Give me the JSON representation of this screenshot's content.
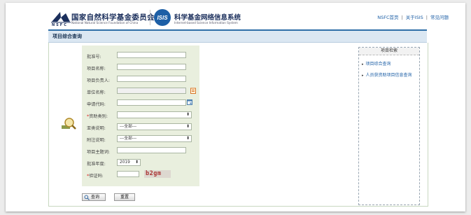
{
  "header": {
    "nsfc_cn": "国家自然科学基金委员会",
    "nsfc_en": "National Natural Science Foundation of China",
    "nsfc_abbr": "NSFC",
    "isis_abbr": "ISIS",
    "isis_cn": "科学基金网络信息系统",
    "isis_en": "Internet-based Science Information System",
    "links": [
      "NSFC首页",
      "关于ISIS",
      "常见问题"
    ],
    "link_separator": "|"
  },
  "page_title": "项目综合查询",
  "form": {
    "fields": [
      {
        "label": "批准号:",
        "type": "text",
        "value": "",
        "required": false
      },
      {
        "label": "项目名称:",
        "type": "text",
        "value": "",
        "required": false
      },
      {
        "label": "项目负责人:",
        "type": "text",
        "value": "",
        "required": false
      },
      {
        "label": "单位名称:",
        "type": "text",
        "value": "",
        "required": false
      },
      {
        "label": "申请代码:",
        "type": "text",
        "value": "",
        "required": false
      },
      {
        "label": "资助类别:",
        "type": "select",
        "value": "",
        "required": true
      },
      {
        "label": "亚类说明:",
        "type": "select",
        "value": "---全部---",
        "required": false
      },
      {
        "label": "附注说明:",
        "type": "select",
        "value": "---全部---",
        "required": false
      },
      {
        "label": "项目主题词:",
        "type": "text",
        "value": "",
        "required": false
      },
      {
        "label": "批准年度:",
        "type": "select",
        "value": "2019",
        "required": false
      },
      {
        "label": "验证码:",
        "type": "text",
        "value": "",
        "required": true
      }
    ],
    "captcha_text": "b2gm",
    "required_mark": "*",
    "search_button": "查询",
    "reset_button": "重置"
  },
  "sidebar": {
    "title": "项目检索",
    "links": [
      "项目综合查询",
      "人员获资助项目信息查询"
    ]
  },
  "colors": {
    "accent_blue": "#2f6fa8",
    "form_bg": "#e9efde",
    "link": "#1d5fa6",
    "captcha": "#a33"
  },
  "icons": [
    "nsfc-logo-icon",
    "isis-logo-icon",
    "magnifier-icon",
    "bucket-icon",
    "calendar-icon"
  ]
}
